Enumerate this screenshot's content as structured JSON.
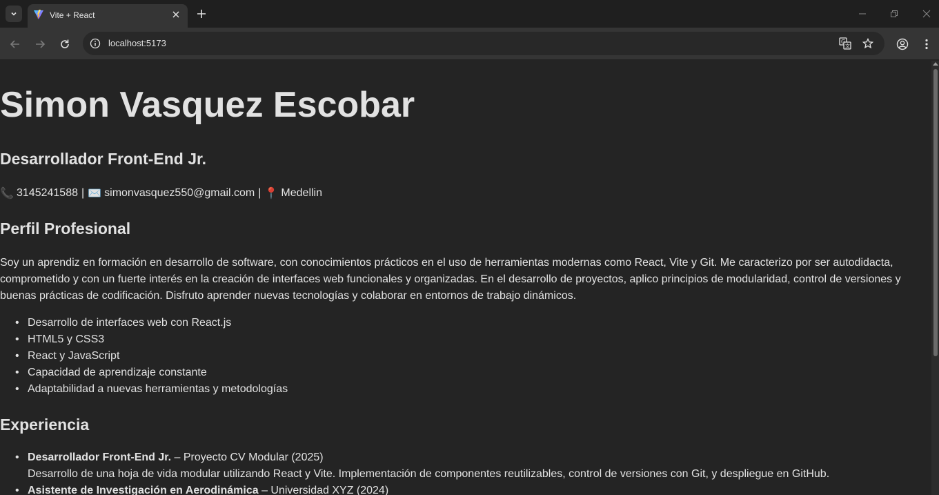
{
  "browser": {
    "tab_title": "Vite + React",
    "url": "localhost:5173"
  },
  "page": {
    "name": "Simon Vasquez Escobar",
    "role": "Desarrollador Front-End Jr.",
    "contact": {
      "phone_icon": "📞",
      "phone": "3145241588",
      "sep": "|",
      "email_icon": "✉️",
      "email": "simonvasquez550@gmail.com",
      "location_icon": "📍",
      "location": "Medellin"
    },
    "profile": {
      "heading": "Perfil Profesional",
      "text": "Soy un aprendiz en formación en desarrollo de software, con conocimientos prácticos en el uso de herramientas modernas como React, Vite y Git. Me caracterizo por ser autodidacta, comprometido y con un fuerte interés en la creación de interfaces web funcionales y organizadas. En el desarrollo de proyectos, aplico principios de modularidad, control de versiones y buenas prácticas de codificación. Disfruto aprender nuevas tecnologías y colaborar en entornos de trabajo dinámicos.",
      "skills": [
        "Desarrollo de interfaces web con React.js",
        "HTML5 y CSS3",
        "React y JavaScript",
        "Capacidad de aprendizaje constante",
        "Adaptabilidad a nuevas herramientas y metodologías"
      ]
    },
    "experience": {
      "heading": "Experiencia",
      "items": [
        {
          "title": "Desarrollador Front-End Jr.",
          "detail": " – Proyecto CV Modular (2025)",
          "desc": "Desarrollo de una hoja de vida modular utilizando React y Vite. Implementación de componentes reutilizables, control de versiones con Git, y despliegue en GitHub."
        },
        {
          "title": "Asistente de Investigación en Aerodinámica",
          "detail": " – Universidad XYZ (2024)",
          "desc": ""
        }
      ]
    }
  },
  "colors": {
    "page_bg": "#242424",
    "text": "rgba(255,255,255,0.87)",
    "chrome_bg": "#1f1f1f",
    "toolbar_bg": "#353535"
  }
}
